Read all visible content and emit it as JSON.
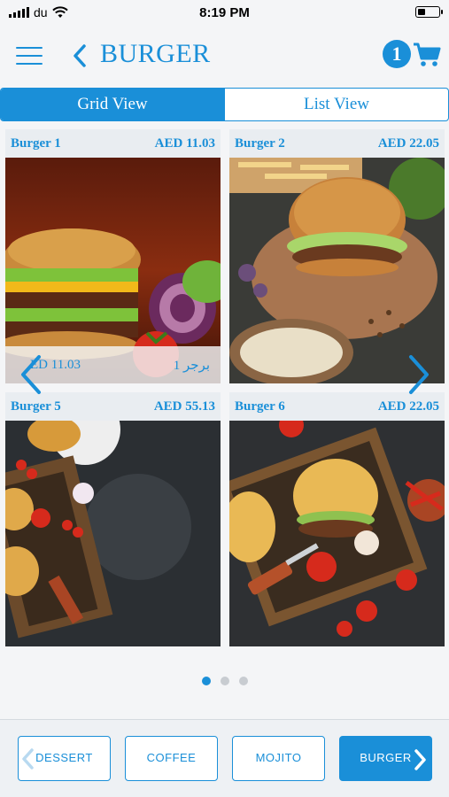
{
  "status_bar": {
    "carrier": "du",
    "time": "8:19 PM",
    "battery_level": 0.35
  },
  "header": {
    "title": "BURGER",
    "cart_count": "1"
  },
  "view_toggle": {
    "grid_label": "Grid View",
    "list_label": "List View",
    "selected": "Grid View"
  },
  "products": [
    {
      "name": "Burger 1",
      "price": "AED 11.03",
      "overlay_price": "ED 11.03",
      "overlay_name_ar": "برجر 1"
    },
    {
      "name": "Burger 2",
      "price": "AED 22.05"
    },
    {
      "name": "Burger 5",
      "price": "AED 55.13"
    },
    {
      "name": "Burger 6",
      "price": "AED 22.05"
    }
  ],
  "pagination": {
    "pages": 3,
    "current": 1
  },
  "categories": [
    {
      "label": "DESSERT",
      "active": false
    },
    {
      "label": "COFFEE",
      "active": false
    },
    {
      "label": "MOJITO",
      "active": false
    },
    {
      "label": "BURGER",
      "active": true
    }
  ],
  "colors": {
    "accent": "#1a8fd8",
    "background": "#f4f5f7"
  }
}
